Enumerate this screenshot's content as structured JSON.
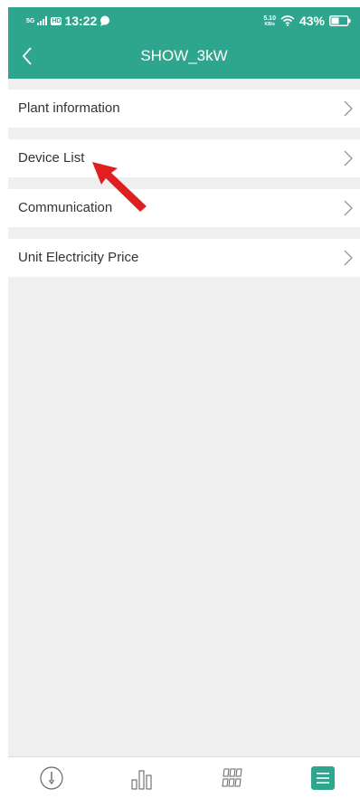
{
  "status_bar": {
    "network": "5G",
    "time": "13:22",
    "speed_value": "5.10",
    "speed_unit": "KB/s",
    "battery": "43%"
  },
  "header": {
    "title": "SHOW_3kW"
  },
  "menu": {
    "items": [
      {
        "label": "Plant information"
      },
      {
        "label": "Device List"
      },
      {
        "label": "Communication"
      },
      {
        "label": "Unit Electricity Price"
      }
    ]
  },
  "tabbar": {
    "tabs": [
      {
        "icon": "gauge-icon",
        "active": false
      },
      {
        "icon": "bar-chart-icon",
        "active": false
      },
      {
        "icon": "grid-icon",
        "active": false
      },
      {
        "icon": "menu-icon",
        "active": true
      }
    ],
    "accent": "#2ea68d"
  },
  "theme": {
    "header_color": "#2ea68d",
    "background": "#efefef",
    "annotation_arrow": "#e02020"
  }
}
